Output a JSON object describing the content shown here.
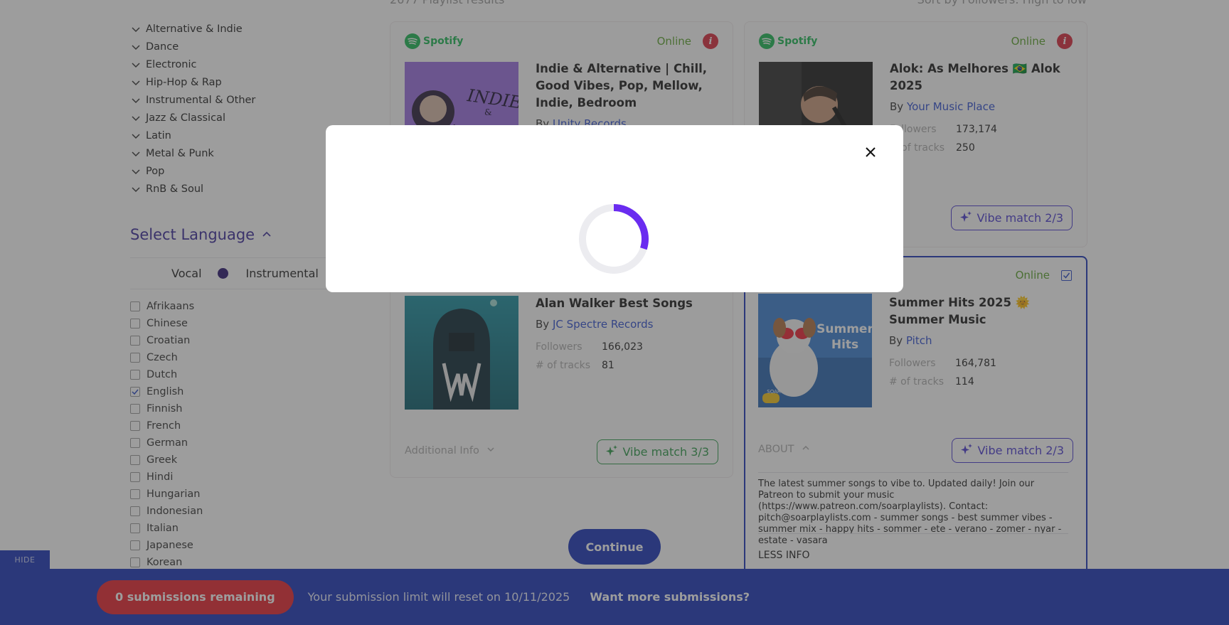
{
  "results_header": {
    "count": "2677 Playlist results",
    "sort": "Sort by Followers: High to low"
  },
  "sidebar": {
    "genres": [
      "Alternative & Indie",
      "Dance",
      "Electronic",
      "Hip-Hop & Rap",
      "Instrumental & Other",
      "Jazz & Classical",
      "Latin",
      "Metal & Punk",
      "Pop",
      "RnB & Soul"
    ],
    "language_title": "Select Language",
    "toggle": {
      "vocal": "Vocal",
      "instrumental": "Instrumental"
    },
    "languages": [
      {
        "label": "Afrikaans",
        "checked": false
      },
      {
        "label": "Chinese",
        "checked": false
      },
      {
        "label": "Croatian",
        "checked": false
      },
      {
        "label": "Czech",
        "checked": false
      },
      {
        "label": "Dutch",
        "checked": false
      },
      {
        "label": "English",
        "checked": true
      },
      {
        "label": "Finnish",
        "checked": false
      },
      {
        "label": "French",
        "checked": false
      },
      {
        "label": "German",
        "checked": false
      },
      {
        "label": "Greek",
        "checked": false
      },
      {
        "label": "Hindi",
        "checked": false
      },
      {
        "label": "Hungarian",
        "checked": false
      },
      {
        "label": "Indonesian",
        "checked": false
      },
      {
        "label": "Italian",
        "checked": false
      },
      {
        "label": "Japanese",
        "checked": false
      },
      {
        "label": "Korean",
        "checked": false
      }
    ],
    "hide_label": "HIDE"
  },
  "cards": {
    "indie": {
      "brand": "Spotify",
      "status": "Online",
      "title": "Indie & Alternative | Chill, Good Vibes, Pop, Mellow, Indie, Bedroom",
      "by": "By",
      "curator": "Unity Records"
    },
    "alok": {
      "brand": "Spotify",
      "status": "Online",
      "title": "Alok: As Melhores 🇧🇷 Alok 2025",
      "by": "By",
      "curator": "Your Music Place",
      "followers_label": "Followers",
      "followers": "173,174",
      "tracks_label": "# of tracks",
      "tracks": "250",
      "vibe": "Vibe match 2/3"
    },
    "walker": {
      "title": "Alan Walker Best Songs",
      "by": "By",
      "curator": "JC Spectre Records",
      "followers_label": "Followers",
      "followers": "166,023",
      "tracks_label": "# of tracks",
      "tracks": "81",
      "additional": "Additional Info",
      "vibe": "Vibe match 3/3"
    },
    "summer": {
      "status": "Online",
      "title": "Summer Hits 2025 🌞 Summer Music",
      "by": "By",
      "curator": "Pitch",
      "followers_label": "Followers",
      "followers": "164,781",
      "tracks_label": "# of tracks",
      "tracks": "114",
      "about": "ABOUT",
      "vibe": "Vibe match 2/3",
      "description": "The latest summer songs to vibe to. Updated daily! Join our Patreon to submit your music (https://www.patreon.com/soarplaylists). Contact: pitch@soarplaylists.com - summer songs - best summer vibes - summer mix - happy hits - sommer - ete - verano - zomer - nyar - estate - vasara",
      "less_info": "LESS INFO",
      "cover_text": "Summer\nHits",
      "cover_small": "SOAR"
    }
  },
  "continue_label": "Continue",
  "bottom_bar": {
    "remaining": "0 submissions remaining",
    "reset_text": "Your submission limit will reset on 10/11/2025",
    "more": "Want more submissions?"
  },
  "modal": {
    "loading_progress": 0.3
  },
  "colors": {
    "brand_blue": "#1a35b8",
    "danger_red": "#e8252e",
    "spotify_green": "#1db954",
    "spinner_accent": "#6a2cf0"
  }
}
